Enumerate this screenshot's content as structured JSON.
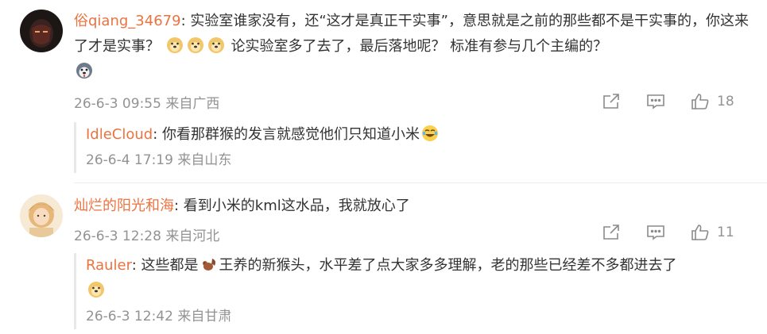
{
  "comments": [
    {
      "username": "俗qiang_34679",
      "text_a": "实验室谁家没有，还“这才是真正干实事”，意思就是之前的那些都不是干实事的，你这来了才是实事？",
      "emojis_a": [
        "doge",
        "doge",
        "doge"
      ],
      "text_b": " 论实验室多了去了，最后落地呢？ 标准有参与几个主编的？",
      "emoji_b": "husky",
      "time": "26-6-3 09:55 来自广西",
      "likes": "18",
      "reply": {
        "username": "IdleCloud",
        "text": "你看那群猴的发言就感觉他们只知道小米",
        "emoji": "laugh-cry",
        "time": "26-6-4 17:19 来自山东"
      }
    },
    {
      "username": "灿烂的阳光和海",
      "text": "看到小米的kml这水品，我就放心了",
      "time": "26-6-3 12:28 来自河北",
      "likes": "11",
      "reply": {
        "username": "Rauler",
        "text_a": "这些都是",
        "emoji_inline": "squirrel",
        "text_b": "王养的新猴头，水平差了点大家多多理解，老的那些已经差不多都进去了",
        "emoji_end": "doge",
        "time": "26-6-3 12:42 来自甘肃"
      }
    }
  ],
  "icons": {
    "share": "share-icon",
    "comment": "comment-icon",
    "like": "like-icon"
  },
  "colors": {
    "username": "#eb7340",
    "meta": "#939393",
    "text": "#333333"
  }
}
